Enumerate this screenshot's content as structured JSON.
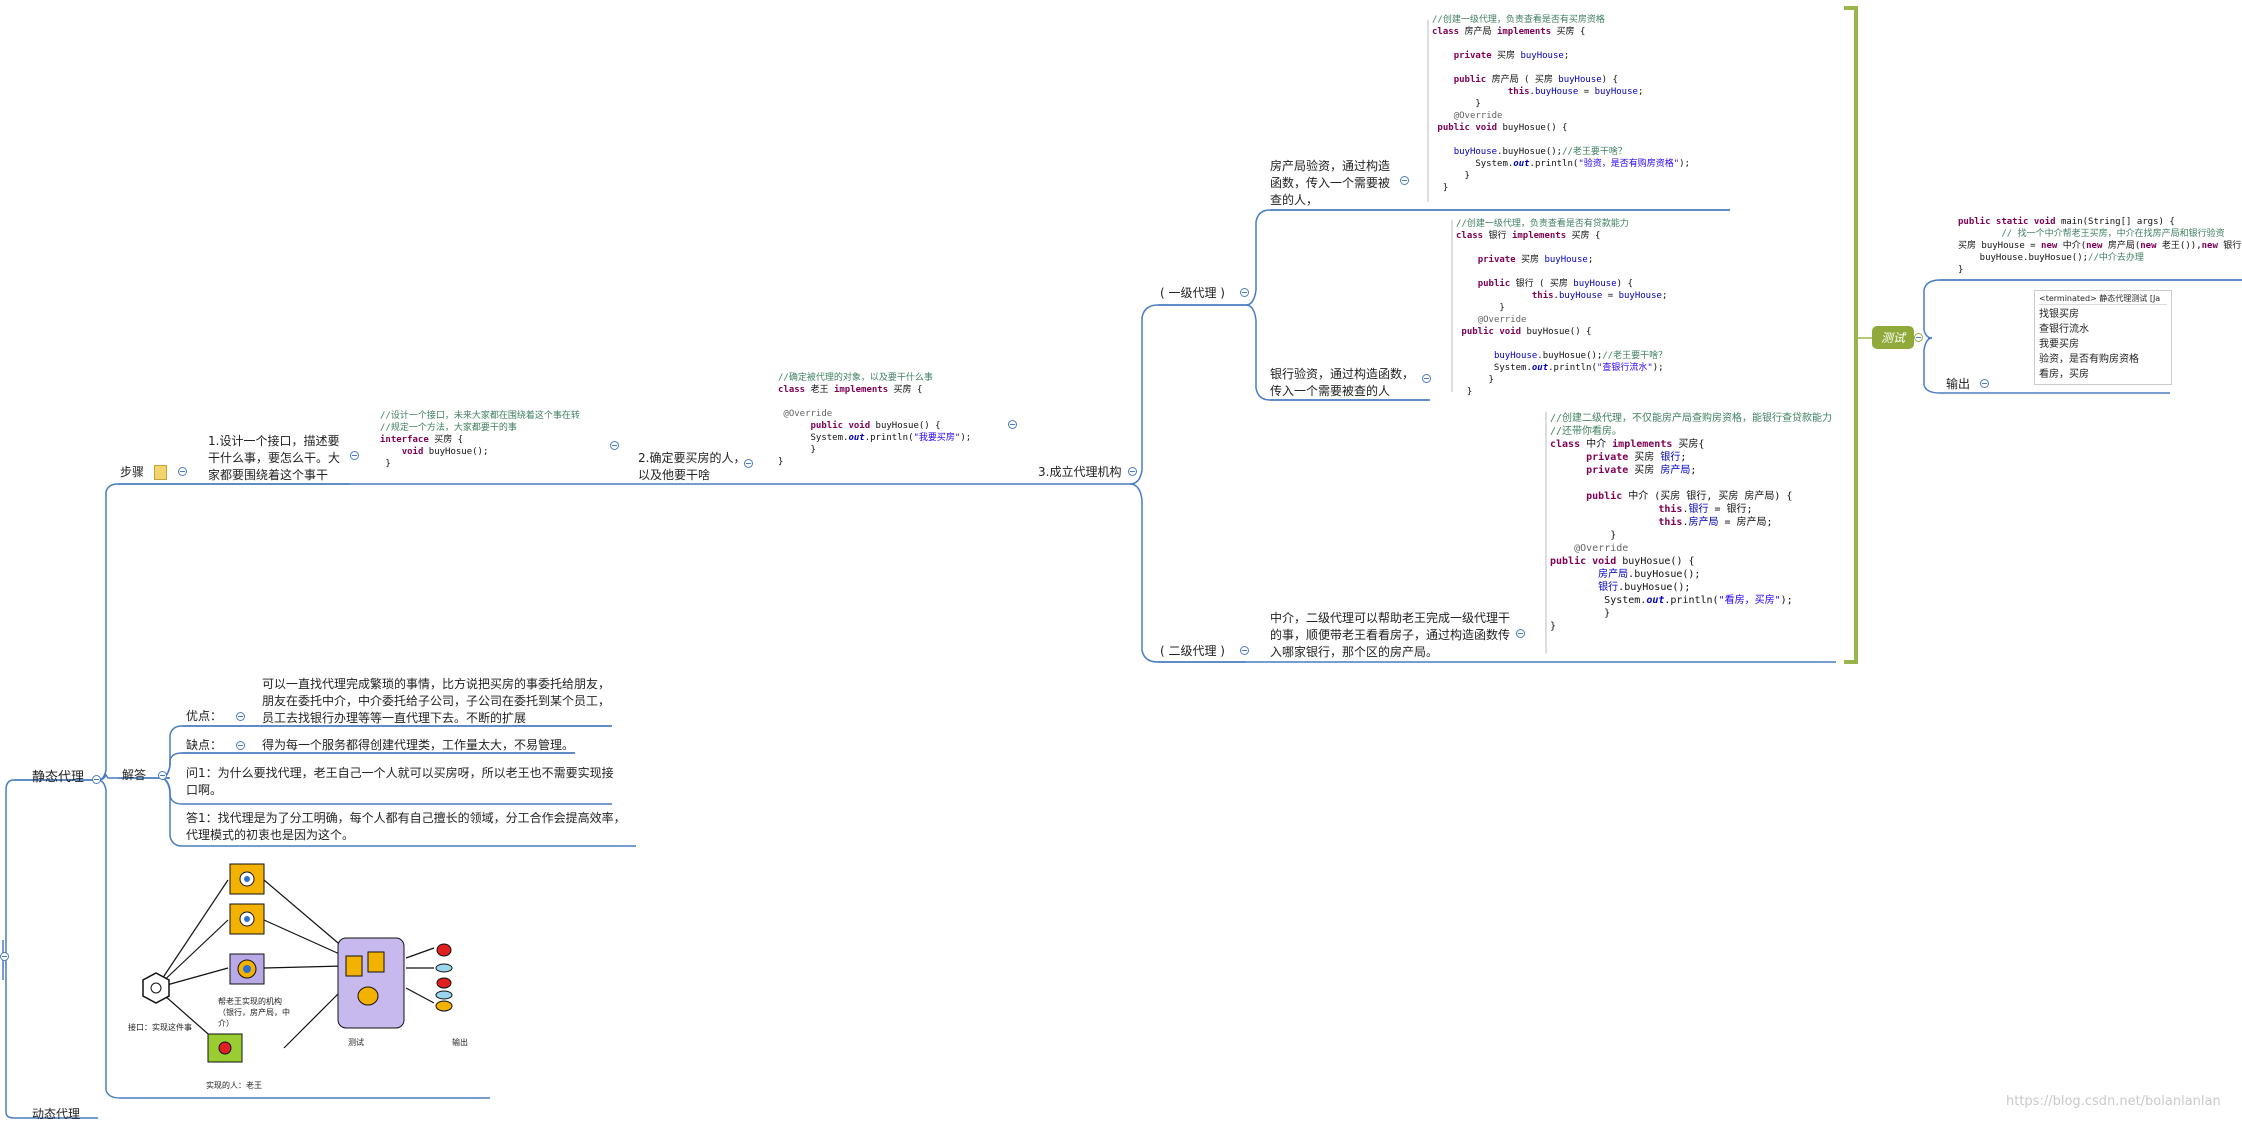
{
  "nodes": {
    "static_proxy": "静态代理",
    "dynamic_proxy": "动态代理",
    "steps": "步骤",
    "step1": "1.设计一个接口，描述要干什么事，要怎么干。大家都要围绕着这个事干",
    "step2": "2.确定要买房的人，以及他要干啥",
    "step3": "3.成立代理机构",
    "level1": "( 一级代理 )",
    "level2": "( 二级代理 )",
    "housing_bureau": "房产局验资，通过构造函数，传入一个需要被查的人，",
    "bank": "银行验资，通过构造函数，传入一个需要被查的人",
    "agent": "中介，二级代理可以帮助老王完成一级代理干的事，顺便带老王看看房子，通过构造函数传入哪家银行，那个区的房产局。",
    "test": "测试",
    "output": "输出",
    "answers": "解答",
    "pros_label": "优点：",
    "pros_text": "可以一直找代理完成繁琐的事情，比方说把买房的事委托给朋友，朋友在委托中介，中介委托给子公司，子公司在委托到某个员工，员工去找银行办理等等一直代理下去。不断的扩展",
    "cons_label": "缺点：",
    "cons_text": "得为每一个服务都得创建代理类，工作量太大，不易管理。",
    "q1": "问1：为什么要找代理，老王自己一个人就可以买房呀，所以老王也不需要实现接口啊。",
    "a1": "答1：找代理是为了分工明确，每个人都有自己擅长的领域，分工合作会提高效率，代理模式的初衷也是因为这个。"
  },
  "code": {
    "interface": [
      "//设计一个接口，未来大家都在围绕着这个事在转",
      "//规定一个方法，大家都要干的事",
      "interface 买房 {",
      "    void buyHosue();",
      " }"
    ],
    "laowang": [
      "//确定被代理的对象，以及要干什么事",
      "class 老王 implements 买房 {",
      "",
      " @Override",
      "      public void buyHosue() {",
      "      System.out.println(\"我要买房\");",
      "      }",
      "}"
    ],
    "housing": [
      "//创建一级代理，负责查看是否有买房资格",
      "class 房产局 implements 买房 {",
      "",
      "    private 买房 buyHouse;",
      "",
      "    public 房产局 ( 买房 buyHouse) {",
      "              this.buyHouse = buyHouse;",
      "        }",
      "    @Override",
      " public void buyHosue() {",
      "",
      "    buyHouse.buyHosue();//老王要干啥？",
      "        System.out.println(\"验资，是否有购房资格\");",
      "      }",
      "  }"
    ],
    "bank": [
      "//创建一级代理，负责查看是否有贷款能力",
      "class 银行 implements 买房 {",
      "",
      "    private 买房 buyHouse;",
      "",
      "    public 银行 ( 买房 buyHouse) {",
      "              this.buyHouse = buyHouse;",
      "        }",
      "    @Override",
      " public void buyHosue() {",
      "",
      "       buyHouse.buyHosue();//老王要干啥？",
      "       System.out.println(\"查银行流水\");",
      "      }",
      "  }"
    ],
    "agent": [
      "//创建二级代理，不仅能房产局查购房资格，能银行查贷款能力",
      "//还带你看房。",
      "class 中介 implements 买房{",
      "      private 买房 银行;",
      "      private 买房 房产局;",
      "",
      "      public 中介 (买房 银行, 买房 房产局) {",
      "                  this.银行 = 银行;",
      "                  this.房产局 = 房产局;",
      "          }",
      "    @Override",
      "public void buyHosue() {",
      "        房产局.buyHosue();",
      "        银行.buyHosue();",
      "         System.out.println(\"看房，买房\");",
      "         }",
      "}"
    ],
    "main": [
      "public static void main(String[] args) {",
      "    // 找一个中介帮老王买房，中介在找房产局和银行验资",
      "买房 buyHouse = new 中介(new 房产局(new 老王()),new 银行(new 老王()));",
      "    buyHouse.buyHosue();//中介去办理",
      "}"
    ]
  },
  "console": {
    "header": "<terminated> 静态代理测试 [Ja",
    "lines": [
      "找银买房",
      "查银行流水",
      "我要买房",
      "验资，是否有购房资格",
      "看房，买房"
    ]
  },
  "diagram_labels": {
    "interface": "接口：实现这件事",
    "agency": "帮老王实现的机构（银行，房产局，中介）",
    "person": "实现的人：老王",
    "test": "测试",
    "output": "输出"
  },
  "watermark": "https://blog.csdn.net/bolanlanlan"
}
